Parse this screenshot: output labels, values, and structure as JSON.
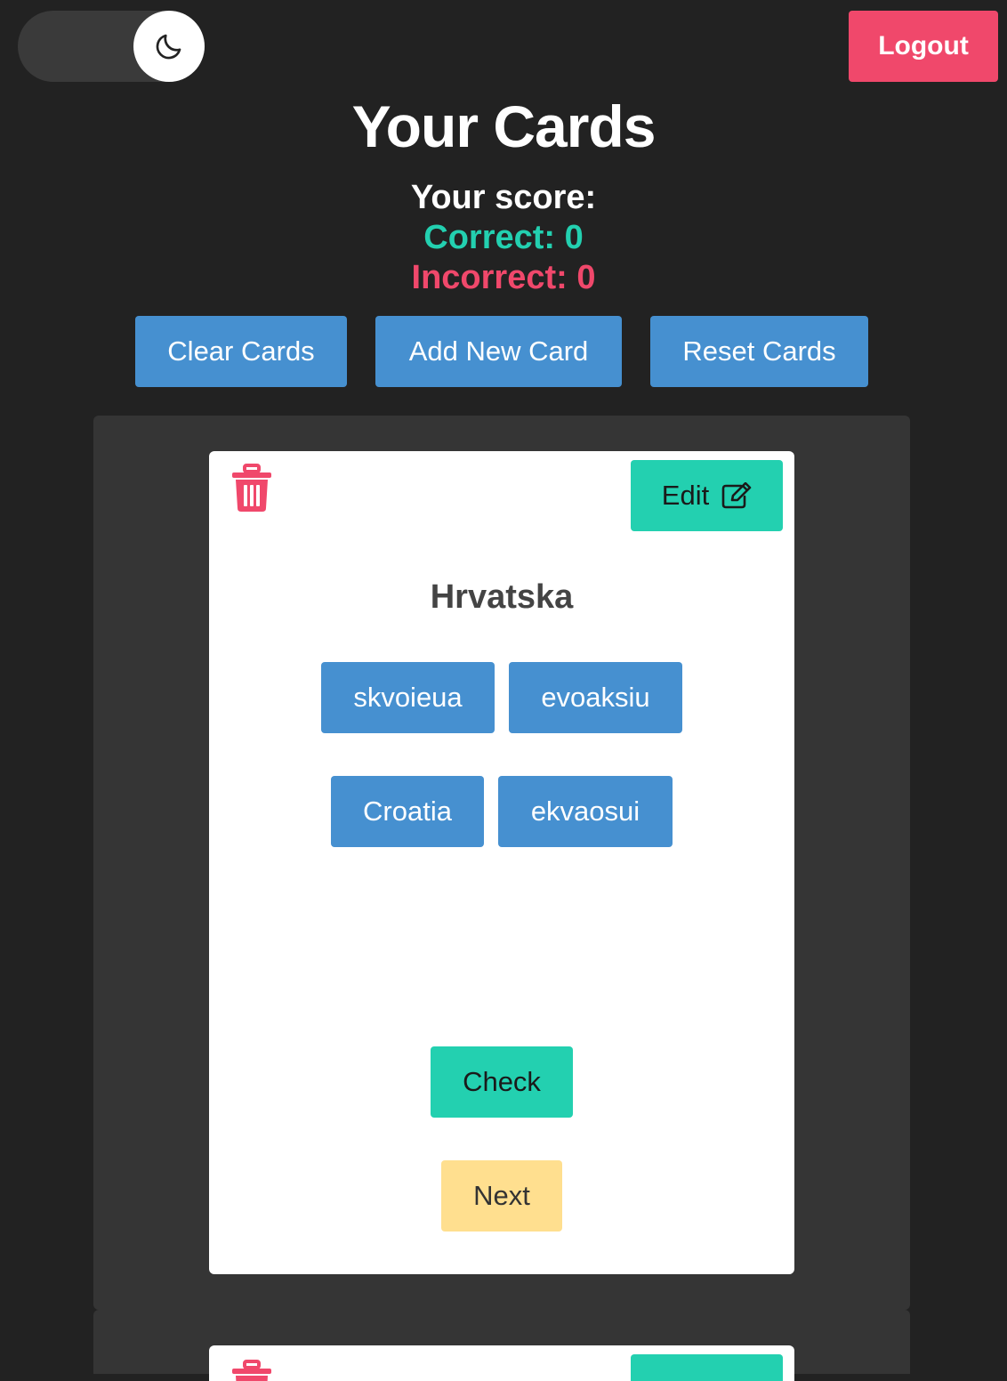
{
  "header": {
    "theme_toggle_icon": "moon-icon",
    "logout_label": "Logout"
  },
  "page_title": "Your Cards",
  "score": {
    "label": "Your score:",
    "correct": "Correct: 0",
    "incorrect": "Incorrect: 0"
  },
  "actions": {
    "clear_label": "Clear Cards",
    "add_label": "Add New Card",
    "reset_label": "Reset Cards"
  },
  "cards": [
    {
      "term": "Hrvatska",
      "edit_label": "Edit",
      "options": [
        "skvoieua",
        "evoaksiu",
        "Croatia",
        "ekvaosui"
      ],
      "check_label": "Check",
      "next_label": "Next"
    }
  ],
  "colors": {
    "background": "#222222",
    "panel": "#353535",
    "primary": "#4690d0",
    "success": "#23d0b0",
    "danger": "#f0486b",
    "warning": "#ffdf8f"
  }
}
